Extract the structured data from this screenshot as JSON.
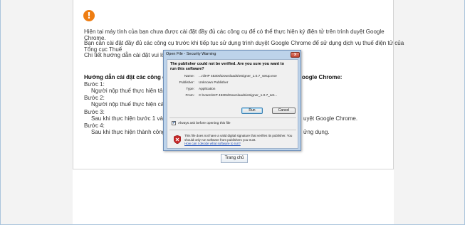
{
  "page": {
    "text_lines": [
      "Hiện tại máy tính của bạn chưa được cài đặt đầy đủ các công cụ để có thể thực hiện ký điện tử trên trình duyệt Google",
      "Chrome.",
      "Bạn cần cài đặt đầy đủ các công cụ trước khi tiếp tục sử dụng trình duyệt Google Chrome để sử dụng dịch vụ thuế điện tử của",
      "Tổng cục Thuế",
      "Chi tiết hướng dẫn cài đặt vui lòng"
    ],
    "guide_heading_left": "Hướng dẫn cài đặt các công cụ",
    "guide_heading_right": "oogle Chrome:",
    "steps": [
      {
        "label": "Bước 1:",
        "text": "Người nộp thuế thực hiện tải v"
      },
      {
        "label": "Bước 2:",
        "text": "Người nộp thuế thực hiện cài đ"
      },
      {
        "label": "Bước 3:",
        "text": "Sau khi thực hiện bước 1 và 2",
        "text_right": "uyệt Google Chrome."
      },
      {
        "label": "Bước 4:",
        "text": "Sau khi thực hiện thành công",
        "text_right": "ửng dụng."
      }
    ],
    "home_button": "Trang chủ"
  },
  "dialog": {
    "title": "Open File - Security Warning",
    "close_label": "x",
    "heading": "The publisher could not be verified.  Are you sure you want to run this software?",
    "rows": [
      {
        "label": "Name:",
        "value": "...ni\\HP 4530s\\Downloads\\eSigner_1.0.7_setup.exe"
      },
      {
        "label": "Publisher:",
        "value": "Unknown Publisher"
      },
      {
        "label": "Type:",
        "value": "Application"
      },
      {
        "label": "From:",
        "value": "C:\\Users\\HP 4530s\\Downloads\\eSigner_1.0.7_set..."
      }
    ],
    "run_button": "Run",
    "cancel_button": "Cancel",
    "checkbox_label": "Always ask before opening this file",
    "checkbox_checked": "✔",
    "warning_text": "This file does not have a valid digital signature that verifies its publisher.  You should only run software from publishers you trust.",
    "warning_link": "How can I decide what software to run?"
  },
  "colors": {
    "warning_orange": "#ee7d12",
    "dialog_frame": "#bdd3ea",
    "shield_red": "#c62828"
  }
}
